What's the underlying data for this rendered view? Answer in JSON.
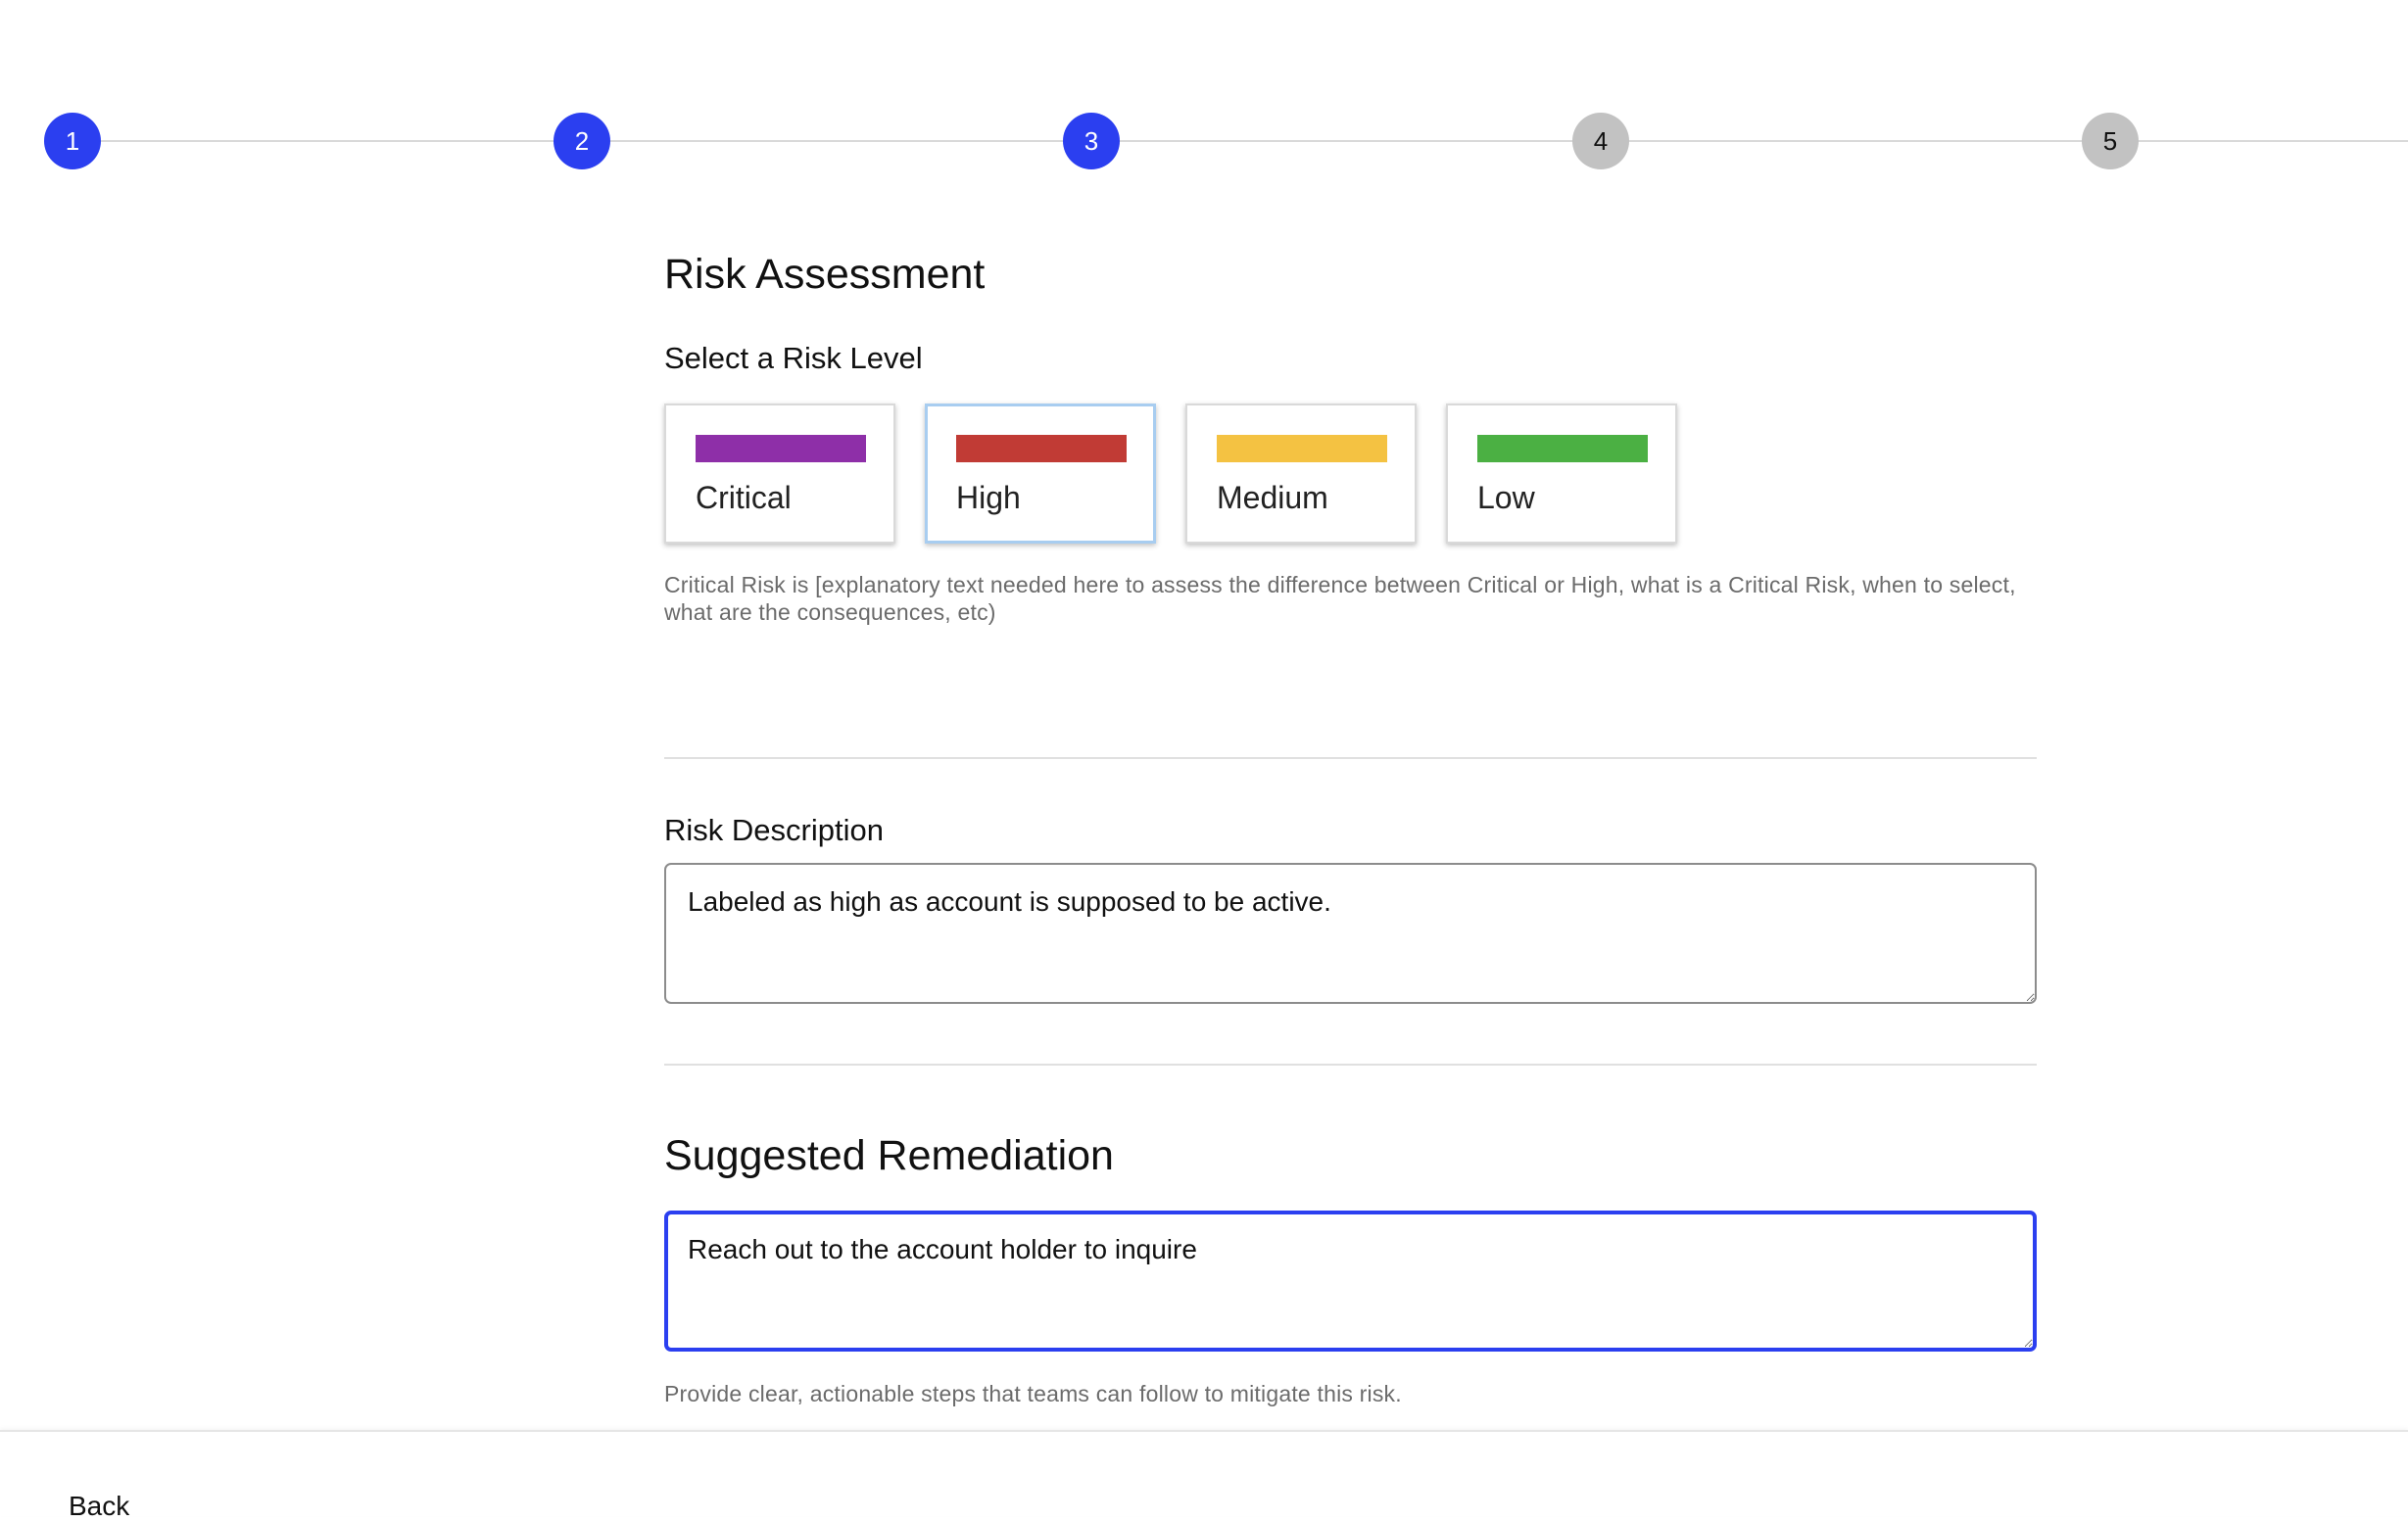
{
  "stepper": {
    "steps": [
      {
        "label": "1",
        "state": "done"
      },
      {
        "label": "2",
        "state": "done"
      },
      {
        "label": "3",
        "state": "active"
      },
      {
        "label": "4",
        "state": "todo"
      },
      {
        "label": "5",
        "state": "todo"
      }
    ],
    "colors": {
      "active": "#2b3ff0",
      "todo": "#c2c2c2"
    }
  },
  "risk_assessment": {
    "title": "Risk Assessment",
    "select_label": "Select a Risk Level",
    "levels": [
      {
        "label": "Critical",
        "color": "#8e2fa8",
        "selected": false
      },
      {
        "label": "High",
        "color": "#c13b35",
        "selected": true
      },
      {
        "label": "Medium",
        "color": "#f4c242",
        "selected": false
      },
      {
        "label": "Low",
        "color": "#4bb043",
        "selected": false
      }
    ],
    "helper_text": "Critical Risk is [explanatory text needed here to assess the difference between Critical or High, what is a Critical Risk, when to select, what are the consequences, etc)"
  },
  "risk_description": {
    "label": "Risk Description",
    "value": "Labeled as high as account is supposed to be active."
  },
  "remediation": {
    "title": "Suggested Remediation",
    "value": "Reach out to the account holder to inquire ",
    "helper_text": "Provide clear, actionable steps that teams can follow to mitigate this risk."
  },
  "footer": {
    "back_label": "Back"
  }
}
